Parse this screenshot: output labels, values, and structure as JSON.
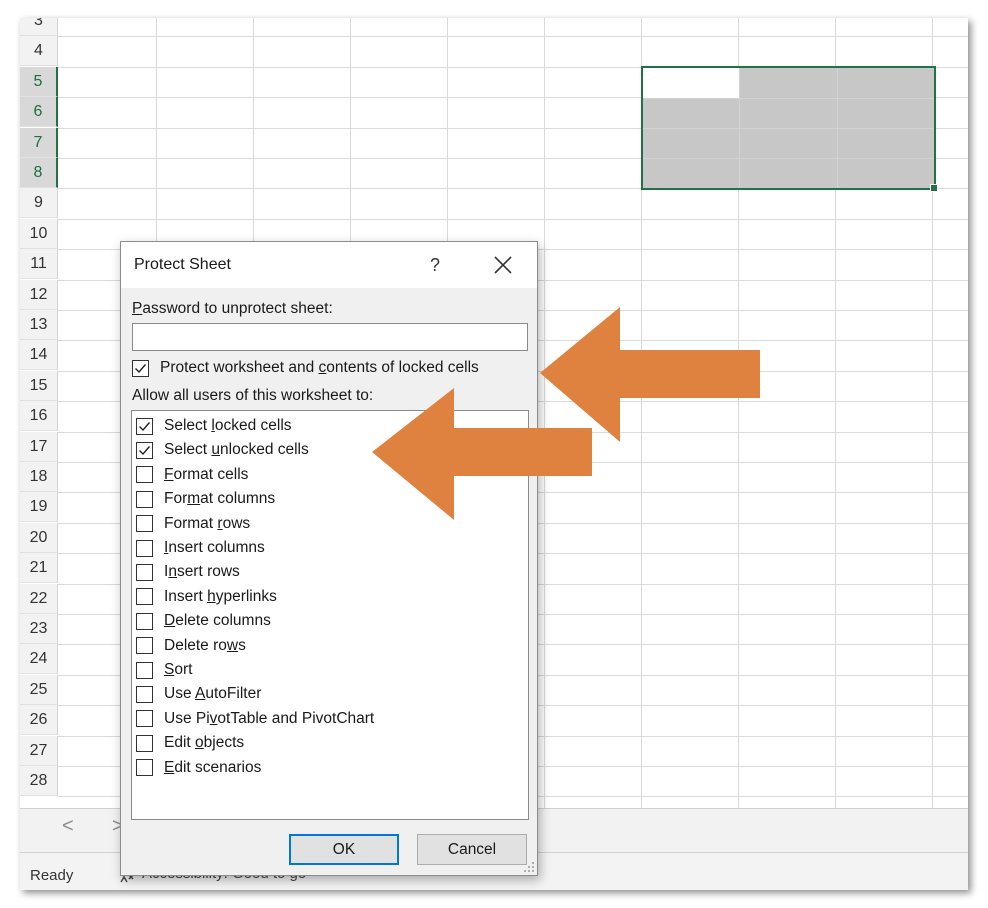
{
  "sheet": {
    "rows": [
      "3",
      "4",
      "5",
      "6",
      "7",
      "8",
      "9",
      "10",
      "11",
      "12",
      "13",
      "14",
      "15",
      "16",
      "17",
      "18",
      "19",
      "20",
      "21",
      "22",
      "23",
      "24",
      "25",
      "26",
      "27",
      "28"
    ],
    "selected_rows": [
      "5",
      "6",
      "7",
      "8"
    ]
  },
  "tabbar": {
    "prev_arrow": "<",
    "next_arrow": ">"
  },
  "statusbar": {
    "ready": "Ready",
    "accessibility": "Accessibility: Good to go"
  },
  "dialog": {
    "title": "Protect Sheet",
    "help_label": "?",
    "password_label_key": "P",
    "password_label_rest": "assword to unprotect sheet:",
    "password_value": "",
    "protect_label_pre": "Protect worksheet and ",
    "protect_label_key": "c",
    "protect_label_post": "ontents of locked cells",
    "protect_checked": true,
    "allow_label": "Allow all users of this worksheet to:",
    "permissions": [
      {
        "pre": "Select ",
        "key": "l",
        "post": "ocked cells",
        "checked": true
      },
      {
        "pre": "Select ",
        "key": "u",
        "post": "nlocked cells",
        "checked": true
      },
      {
        "pre": "",
        "key": "F",
        "post": "ormat cells",
        "checked": false
      },
      {
        "pre": "For",
        "key": "m",
        "post": "at columns",
        "checked": false
      },
      {
        "pre": "Format ",
        "key": "r",
        "post": "ows",
        "checked": false
      },
      {
        "pre": "",
        "key": "I",
        "post": "nsert columns",
        "checked": false
      },
      {
        "pre": "I",
        "key": "n",
        "post": "sert rows",
        "checked": false
      },
      {
        "pre": "Insert ",
        "key": "h",
        "post": "yperlinks",
        "checked": false
      },
      {
        "pre": "",
        "key": "D",
        "post": "elete columns",
        "checked": false
      },
      {
        "pre": "Delete ro",
        "key": "w",
        "post": "s",
        "checked": false
      },
      {
        "pre": "",
        "key": "S",
        "post": "ort",
        "checked": false
      },
      {
        "pre": "Use ",
        "key": "A",
        "post": "utoFilter",
        "checked": false
      },
      {
        "pre": "Use Pi",
        "key": "v",
        "post": "otTable and PivotChart",
        "checked": false
      },
      {
        "pre": "Edit ",
        "key": "o",
        "post": "bjects",
        "checked": false
      },
      {
        "pre": "",
        "key": "E",
        "post": "dit scenarios",
        "checked": false
      }
    ],
    "ok_label": "OK",
    "cancel_label": "Cancel"
  },
  "colors": {
    "excel_green": "#217346",
    "arrow_orange": "#E0823F",
    "ok_focus_blue": "#0078d7"
  }
}
